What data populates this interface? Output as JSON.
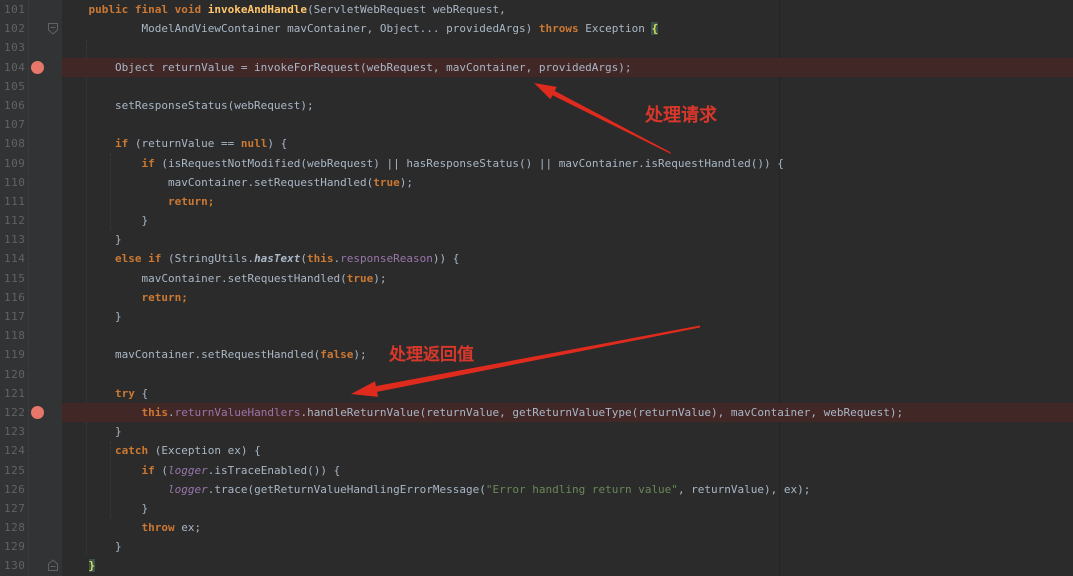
{
  "colors": {
    "editor_bg": "#2b2b2b",
    "gutter_bg": "#313335",
    "line_number": "#606366",
    "hlbg": "#422727",
    "bp": "#e8776b",
    "bracebg": "#3b514d",
    "bracefg": "#d5e157",
    "anno": "#d8372b",
    "margin_guide": "#242424"
  },
  "token_colors": {
    "kw": "#cc7832",
    "plain": "#a9b7c6",
    "decl": "#ffc66d",
    "field": "#9876aa",
    "string": "#6a8759"
  },
  "annotations": {
    "request": {
      "text": "处理请求"
    },
    "return_value": {
      "text": "处理返回值"
    }
  },
  "lines": [
    {
      "num": "101",
      "indent": 4,
      "tokens": [
        [
          "kw",
          "public final void "
        ],
        [
          "decl",
          "invokeAndHandle"
        ],
        [
          "plain",
          "(ServletWebRequest webRequest,"
        ]
      ],
      "breakpoint": false,
      "highlight": false,
      "fold": null
    },
    {
      "num": "102",
      "indent": 12,
      "tokens": [
        [
          "plain",
          "ModelAndViewContainer mavContainer, Object... providedArgs) "
        ],
        [
          "kw",
          "throws"
        ],
        [
          "plain",
          " Exception "
        ],
        [
          "bracehl",
          "{"
        ]
      ],
      "breakpoint": false,
      "highlight": false,
      "fold": "open"
    },
    {
      "num": "103",
      "indent": 0,
      "tokens": [],
      "breakpoint": false,
      "highlight": false,
      "fold": null
    },
    {
      "num": "104",
      "indent": 8,
      "tokens": [
        [
          "plain",
          "Object returnValue = invokeForRequest(webRequest, mavContainer, providedArgs);"
        ]
      ],
      "breakpoint": true,
      "highlight": true,
      "fold": null
    },
    {
      "num": "105",
      "indent": 0,
      "tokens": [],
      "breakpoint": false,
      "highlight": false,
      "fold": null
    },
    {
      "num": "106",
      "indent": 8,
      "tokens": [
        [
          "plain",
          "setResponseStatus(webRequest);"
        ]
      ],
      "breakpoint": false,
      "highlight": false,
      "fold": null
    },
    {
      "num": "107",
      "indent": 0,
      "tokens": [],
      "breakpoint": false,
      "highlight": false,
      "fold": null
    },
    {
      "num": "108",
      "indent": 8,
      "tokens": [
        [
          "kw",
          "if"
        ],
        [
          "plain",
          " (returnValue == "
        ],
        [
          "kw",
          "null"
        ],
        [
          "plain",
          ") {"
        ]
      ],
      "breakpoint": false,
      "highlight": false,
      "fold": null
    },
    {
      "num": "109",
      "indent": 12,
      "tokens": [
        [
          "kw",
          "if"
        ],
        [
          "plain",
          " (isRequestNotModified(webRequest) || hasResponseStatus() || mavContainer.isRequestHandled()) {"
        ]
      ],
      "breakpoint": false,
      "highlight": false,
      "fold": null
    },
    {
      "num": "110",
      "indent": 16,
      "tokens": [
        [
          "plain",
          "mavContainer.setRequestHandled("
        ],
        [
          "kw",
          "true"
        ],
        [
          "plain",
          ");"
        ]
      ],
      "breakpoint": false,
      "highlight": false,
      "fold": null
    },
    {
      "num": "111",
      "indent": 16,
      "tokens": [
        [
          "kw",
          "return;"
        ]
      ],
      "breakpoint": false,
      "highlight": false,
      "fold": null
    },
    {
      "num": "112",
      "indent": 12,
      "tokens": [
        [
          "plain",
          "}"
        ]
      ],
      "breakpoint": false,
      "highlight": false,
      "fold": null
    },
    {
      "num": "113",
      "indent": 8,
      "tokens": [
        [
          "plain",
          "}"
        ]
      ],
      "breakpoint": false,
      "highlight": false,
      "fold": null
    },
    {
      "num": "114",
      "indent": 8,
      "tokens": [
        [
          "kw",
          "else if"
        ],
        [
          "plain",
          " (StringUtils."
        ],
        [
          "stm",
          "hasText"
        ],
        [
          "plain",
          "("
        ],
        [
          "kw",
          "this"
        ],
        [
          "plain",
          "."
        ],
        [
          "field",
          "responseReason"
        ],
        [
          "plain",
          ")) {"
        ]
      ],
      "breakpoint": false,
      "highlight": false,
      "fold": null
    },
    {
      "num": "115",
      "indent": 12,
      "tokens": [
        [
          "plain",
          "mavContainer.setRequestHandled("
        ],
        [
          "kw",
          "true"
        ],
        [
          "plain",
          ");"
        ]
      ],
      "breakpoint": false,
      "highlight": false,
      "fold": null
    },
    {
      "num": "116",
      "indent": 12,
      "tokens": [
        [
          "kw",
          "return;"
        ]
      ],
      "breakpoint": false,
      "highlight": false,
      "fold": null
    },
    {
      "num": "117",
      "indent": 8,
      "tokens": [
        [
          "plain",
          "}"
        ]
      ],
      "breakpoint": false,
      "highlight": false,
      "fold": null
    },
    {
      "num": "118",
      "indent": 0,
      "tokens": [],
      "breakpoint": false,
      "highlight": false,
      "fold": null
    },
    {
      "num": "119",
      "indent": 8,
      "tokens": [
        [
          "plain",
          "mavContainer.setRequestHandled("
        ],
        [
          "kw",
          "false"
        ],
        [
          "plain",
          ");"
        ]
      ],
      "breakpoint": false,
      "highlight": false,
      "fold": null
    },
    {
      "num": "120",
      "indent": 0,
      "tokens": [],
      "breakpoint": false,
      "highlight": false,
      "fold": null
    },
    {
      "num": "121",
      "indent": 8,
      "tokens": [
        [
          "kw",
          "try"
        ],
        [
          "plain",
          " {"
        ]
      ],
      "breakpoint": false,
      "highlight": false,
      "fold": null
    },
    {
      "num": "122",
      "indent": 12,
      "tokens": [
        [
          "kw",
          "this"
        ],
        [
          "plain",
          "."
        ],
        [
          "field",
          "returnValueHandlers"
        ],
        [
          "plain",
          ".handleReturnValue(returnValue, getReturnValueType(returnValue), mavContainer, webRequest);"
        ]
      ],
      "breakpoint": true,
      "highlight": true,
      "fold": null
    },
    {
      "num": "123",
      "indent": 8,
      "tokens": [
        [
          "plain",
          "}"
        ]
      ],
      "breakpoint": false,
      "highlight": false,
      "fold": null
    },
    {
      "num": "124",
      "indent": 8,
      "tokens": [
        [
          "kw",
          "catch"
        ],
        [
          "plain",
          " (Exception ex) {"
        ]
      ],
      "breakpoint": false,
      "highlight": false,
      "fold": null
    },
    {
      "num": "125",
      "indent": 12,
      "tokens": [
        [
          "kw",
          "if"
        ],
        [
          "plain",
          " ("
        ],
        [
          "fieldi",
          "logger"
        ],
        [
          "plain",
          ".isTraceEnabled()) {"
        ]
      ],
      "breakpoint": false,
      "highlight": false,
      "fold": null
    },
    {
      "num": "126",
      "indent": 16,
      "tokens": [
        [
          "fieldi",
          "logger"
        ],
        [
          "plain",
          ".trace(getReturnValueHandlingErrorMessage("
        ],
        [
          "string",
          "\"Error handling return value\""
        ],
        [
          "plain",
          ", returnValue), ex);"
        ]
      ],
      "breakpoint": false,
      "highlight": false,
      "fold": null
    },
    {
      "num": "127",
      "indent": 12,
      "tokens": [
        [
          "plain",
          "}"
        ]
      ],
      "breakpoint": false,
      "highlight": false,
      "fold": null
    },
    {
      "num": "128",
      "indent": 12,
      "tokens": [
        [
          "kw",
          "throw"
        ],
        [
          "plain",
          " ex;"
        ]
      ],
      "breakpoint": false,
      "highlight": false,
      "fold": null
    },
    {
      "num": "129",
      "indent": 8,
      "tokens": [
        [
          "plain",
          "}"
        ]
      ],
      "breakpoint": false,
      "highlight": false,
      "fold": null
    },
    {
      "num": "130",
      "indent": 4,
      "tokens": [
        [
          "bracehl",
          "}"
        ]
      ],
      "breakpoint": false,
      "highlight": false,
      "fold": "close"
    }
  ]
}
